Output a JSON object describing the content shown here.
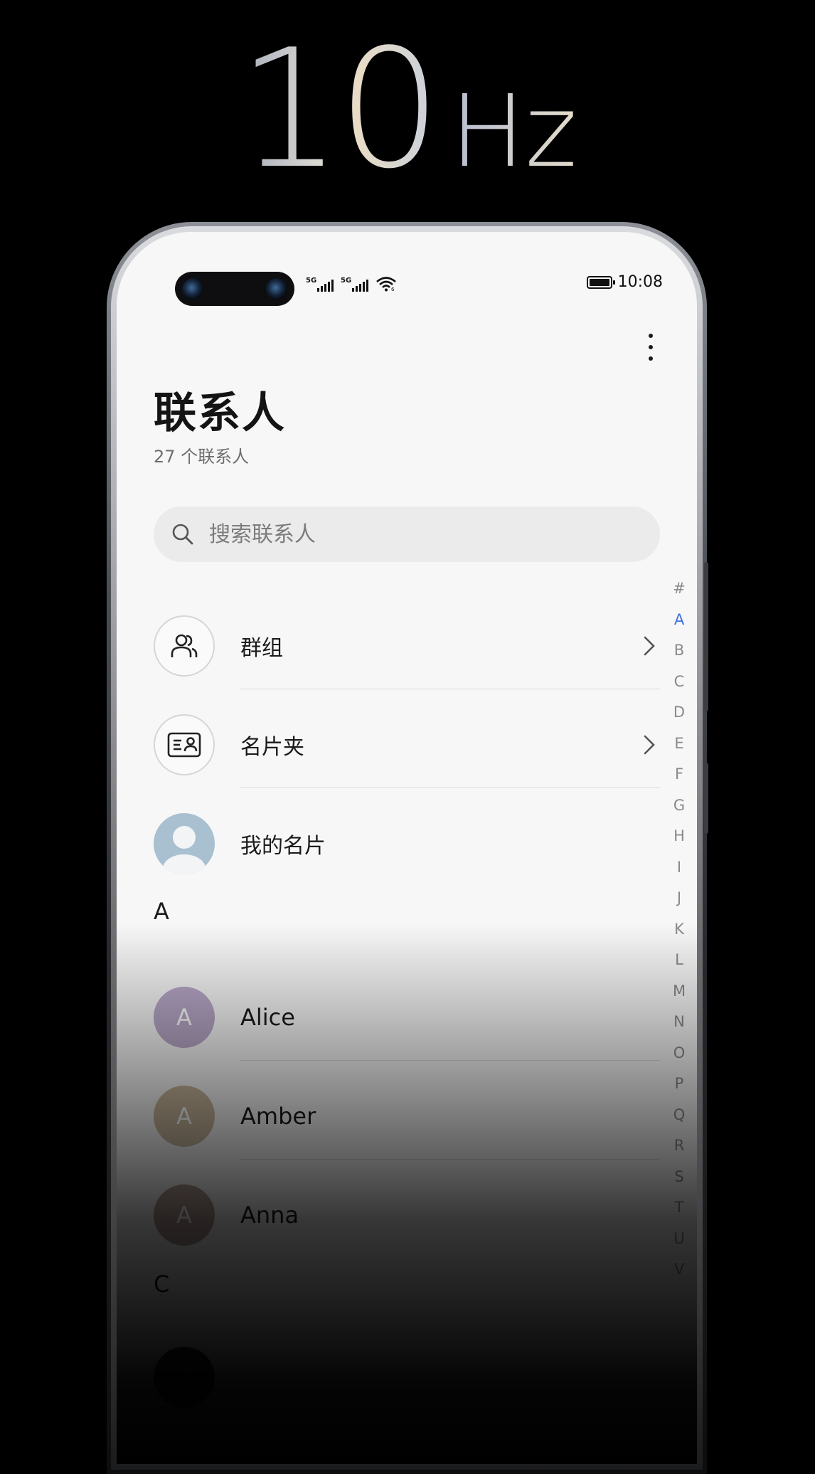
{
  "hero": {
    "number": "10",
    "unit": "Hz"
  },
  "status": {
    "signal1": "5G",
    "signal2": "5G",
    "time": "10:08"
  },
  "header": {
    "title": "联系人",
    "subtitle": "27 个联系人"
  },
  "search": {
    "placeholder": "搜索联系人"
  },
  "shortcuts": [
    {
      "label": "群组",
      "icon": "group-icon"
    },
    {
      "label": "名片夹",
      "icon": "business-card-icon"
    },
    {
      "label": "我的名片",
      "icon": "avatar"
    }
  ],
  "sections": [
    {
      "letter": "A",
      "contacts": [
        {
          "name": "Alice",
          "initial": "A",
          "color": "#b9a9c9"
        },
        {
          "name": "Amber",
          "initial": "A",
          "color": "#c8b79c"
        },
        {
          "name": "Anna",
          "initial": "A",
          "color": "#b09a94"
        }
      ]
    },
    {
      "letter": "C",
      "contacts": [
        {
          "name": "",
          "initial": "",
          "color": "#2a2a2a"
        }
      ]
    }
  ],
  "alpha_index": [
    "#",
    "A",
    "B",
    "C",
    "D",
    "E",
    "F",
    "G",
    "H",
    "I",
    "J",
    "K",
    "L",
    "M",
    "N",
    "O",
    "P",
    "Q",
    "R",
    "S",
    "T",
    "U",
    "V"
  ],
  "alpha_active": "A",
  "colors": {
    "accent": "#3f6fe0",
    "background": "#f7f7f7"
  }
}
